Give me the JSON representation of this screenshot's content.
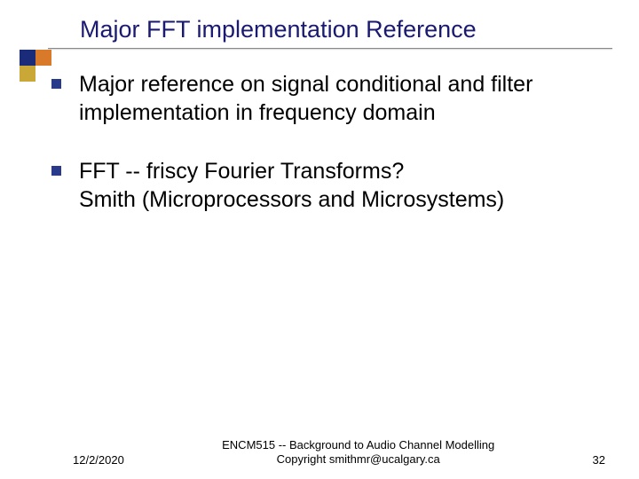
{
  "title": "Major FFT implementation Reference",
  "bullets": [
    {
      "text": "Major reference on signal conditional and filter implementation in frequency domain"
    },
    {
      "text": "FFT -- friscy Fourier Transforms?\nSmith (Microprocessors and Microsystems)"
    }
  ],
  "footer": {
    "date": "12/2/2020",
    "center_line1": "ENCM515 -- Background to Audio Channel Modelling",
    "center_line2": "Copyright smithmr@ucalgary.ca",
    "page": "32"
  },
  "colors": {
    "title": "#1a1a70",
    "bullet_square": "#2a3a8a",
    "corner_navy": "#1a2b7a",
    "corner_orange": "#d87a2a",
    "corner_gold": "#c9a838"
  }
}
